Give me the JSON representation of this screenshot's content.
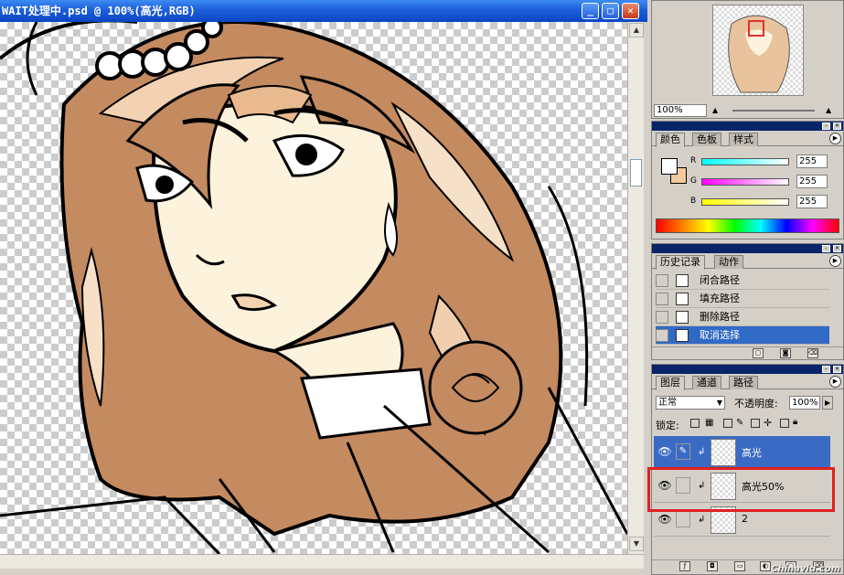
{
  "document": {
    "title": "WAIT处理中.psd @ 100%(高光,RGB)"
  },
  "navigator": {
    "zoom": "100%"
  },
  "color_panel": {
    "tabs": [
      "颜色",
      "色板",
      "样式"
    ],
    "channels": [
      {
        "label": "R",
        "value": "255",
        "gradient": "#00ffff"
      },
      {
        "label": "G",
        "value": "255",
        "gradient": "#ff00ff"
      },
      {
        "label": "B",
        "value": "255",
        "gradient": "#ffff00"
      }
    ],
    "foreground": "#ffffff",
    "background": "#f5c9a0"
  },
  "history_panel": {
    "tabs": [
      "历史记录",
      "动作"
    ],
    "items": [
      {
        "label": "闭合路径",
        "selected": false
      },
      {
        "label": "填充路径",
        "selected": false
      },
      {
        "label": "删除路径",
        "selected": false
      },
      {
        "label": "取消选择",
        "selected": true
      }
    ]
  },
  "layers_panel": {
    "tabs": [
      "图层",
      "通道",
      "路径"
    ],
    "blend_mode": "正常",
    "opacity_label": "不透明度:",
    "opacity_value": "100%",
    "lock_label": "锁定:",
    "layers": [
      {
        "name": "高光",
        "selected": true,
        "visible": true
      },
      {
        "name": "高光50%",
        "selected": false,
        "visible": true
      },
      {
        "name": "2",
        "selected": false,
        "visible": true
      }
    ]
  },
  "watermark": "Chinavid.com",
  "highlight_color": "#e02020"
}
